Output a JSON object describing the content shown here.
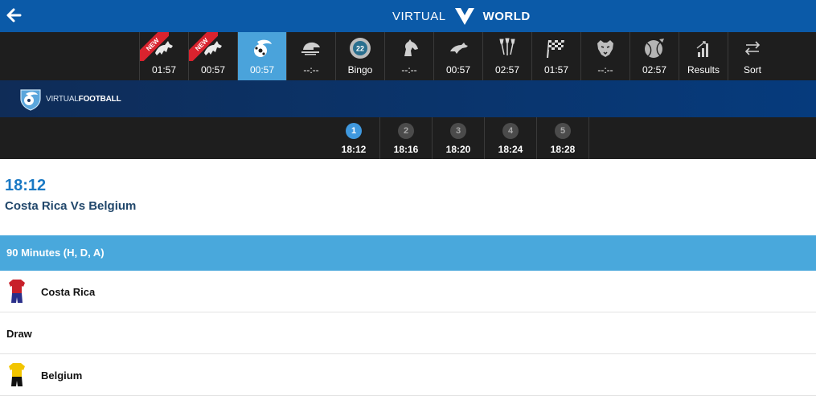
{
  "header": {
    "brand_left": "VIRTUAL",
    "brand_right": "WORLD",
    "back_icon": "arrow-left-icon",
    "colors": {
      "bar": "#0b5aa8"
    }
  },
  "games": [
    {
      "icon": "horse-racing-icon",
      "time": "01:57",
      "badge": "NEW"
    },
    {
      "icon": "horse-racing-icon",
      "time": "00:57",
      "badge": "NEW"
    },
    {
      "icon": "football-icon",
      "time": "00:57",
      "active": true
    },
    {
      "icon": "motor-racing-icon",
      "time": "--:--"
    },
    {
      "icon": "bingo-ball-icon",
      "time": "Bingo",
      "ball": "22"
    },
    {
      "icon": "horse-head-icon",
      "time": "--:--"
    },
    {
      "icon": "greyhound-icon",
      "time": "00:57"
    },
    {
      "icon": "darts-icon",
      "time": "02:57"
    },
    {
      "icon": "chequered-flag-icon",
      "time": "01:57"
    },
    {
      "icon": "panther-icon",
      "time": "--:--"
    },
    {
      "icon": "tennis-ball-icon",
      "time": "02:57"
    },
    {
      "icon": "results-chart-icon",
      "time": "Results"
    },
    {
      "icon": "sort-arrows-icon",
      "time": "Sort"
    }
  ],
  "banner": {
    "title_light": "VIRTUAL",
    "title_bold": "FOOTBALL"
  },
  "events": [
    {
      "num": "1",
      "time": "18:12",
      "active": true
    },
    {
      "num": "2",
      "time": "18:16"
    },
    {
      "num": "3",
      "time": "18:20"
    },
    {
      "num": "4",
      "time": "18:24"
    },
    {
      "num": "5",
      "time": "18:28"
    }
  ],
  "event": {
    "time": "18:12",
    "title": "Costa Rica Vs Belgium"
  },
  "market": {
    "name": "90 Minutes (H, D, A)",
    "selections": [
      {
        "name": "Costa Rica",
        "kit": "costa-rica-kit-icon",
        "shirt_color": "#c8202a",
        "shorts_color": "#2a2f8a"
      },
      {
        "name": "Draw"
      },
      {
        "name": "Belgium",
        "kit": "belgium-kit-icon",
        "shirt_color": "#f2c500",
        "shorts_color": "#111111"
      }
    ]
  }
}
